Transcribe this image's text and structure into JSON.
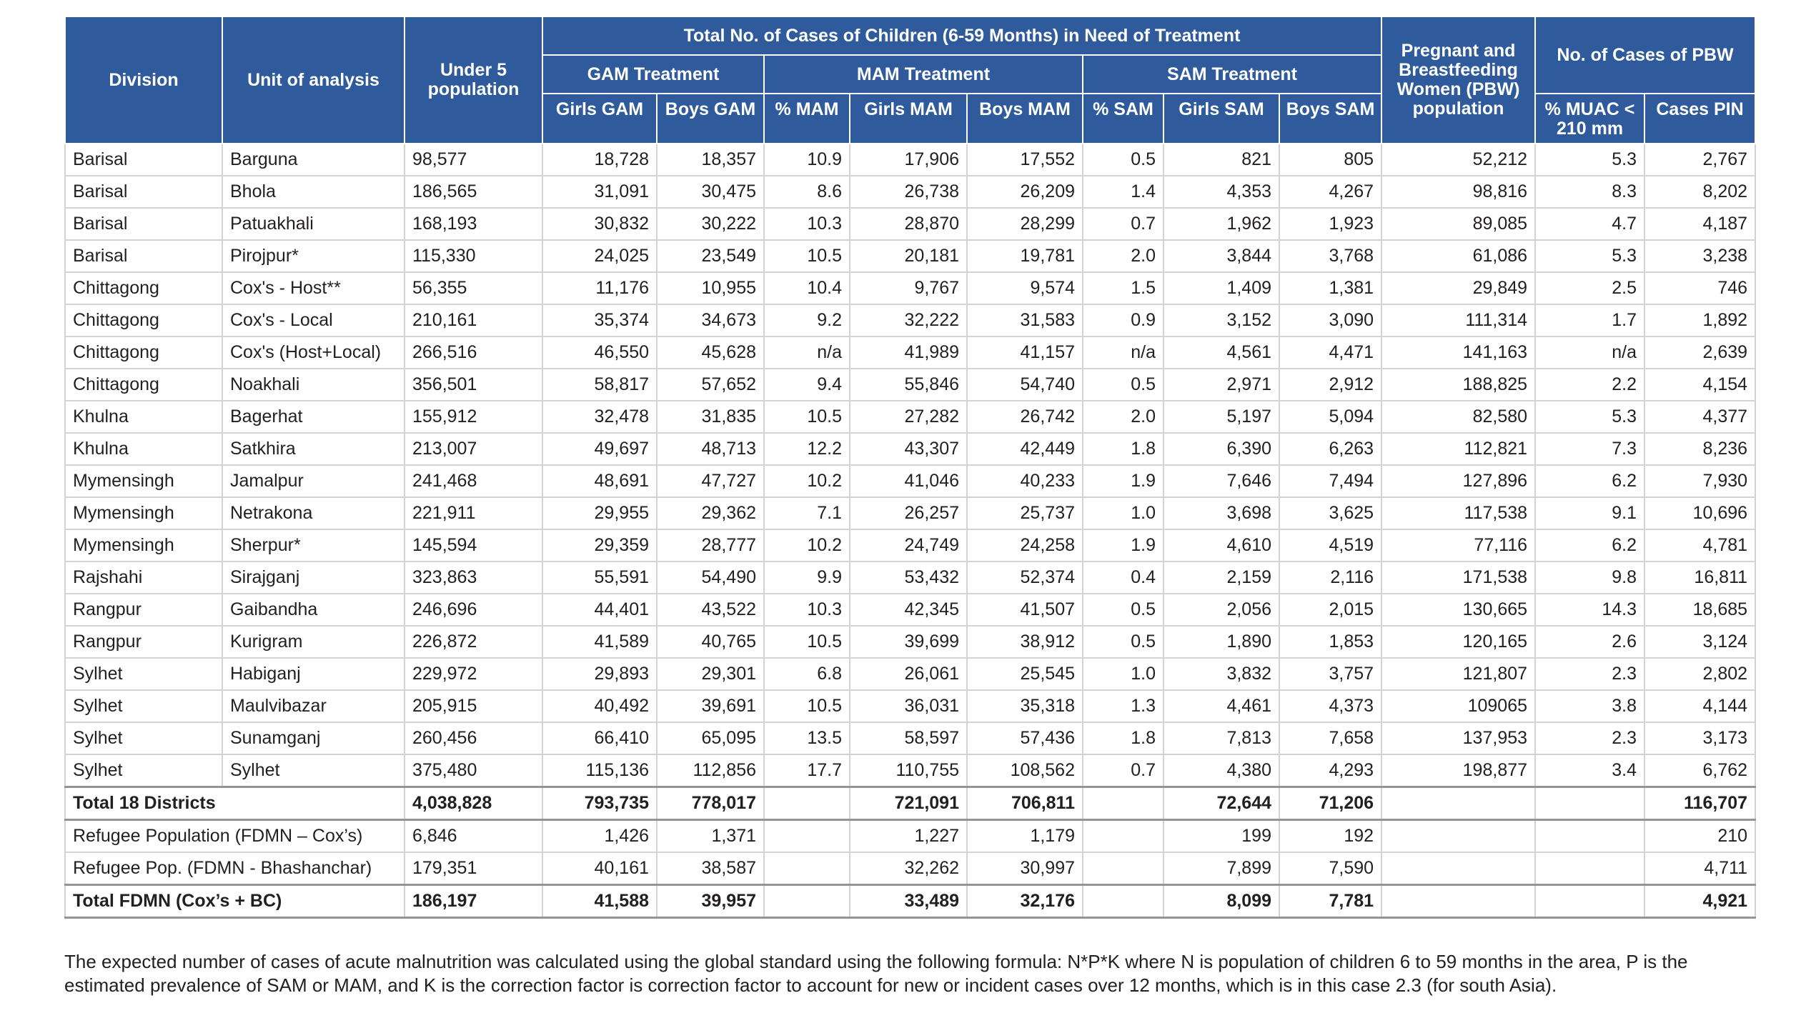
{
  "headers": {
    "division": "Division",
    "unit": "Unit of analysis",
    "under5": "Under 5 population",
    "total_cases": "Total No. of Cases of Children (6-59 Months) in Need of Treatment",
    "gam": "GAM Treatment",
    "mam": "MAM Treatment",
    "sam": "SAM Treatment",
    "pbw_pop": "Pregnant and Breastfeeding Women (PBW) population",
    "pbw_cases": "No. of Cases of PBW",
    "girls_gam": "Girls GAM",
    "boys_gam": "Boys GAM",
    "pct_mam": "% MAM",
    "girls_mam": "Girls MAM",
    "boys_mam": "Boys MAM",
    "pct_sam": "% SAM",
    "girls_sam": "Girls SAM",
    "boys_sam": "Boys SAM",
    "pct_muac": "% MUAC < 210 mm",
    "cases_pin": "Cases PIN"
  },
  "rows": [
    [
      "Barisal",
      "Barguna",
      "98,577",
      "18,728",
      "18,357",
      "10.9",
      "17,906",
      "17,552",
      "0.5",
      "821",
      "805",
      "52,212",
      "5.3",
      "2,767"
    ],
    [
      "Barisal",
      "Bhola",
      "186,565",
      "31,091",
      "30,475",
      "8.6",
      "26,738",
      "26,209",
      "1.4",
      "4,353",
      "4,267",
      "98,816",
      "8.3",
      "8,202"
    ],
    [
      "Barisal",
      "Patuakhali",
      "168,193",
      "30,832",
      "30,222",
      "10.3",
      "28,870",
      "28,299",
      "0.7",
      "1,962",
      "1,923",
      "89,085",
      "4.7",
      "4,187"
    ],
    [
      "Barisal",
      "Pirojpur*",
      "115,330",
      "24,025",
      "23,549",
      "10.5",
      "20,181",
      "19,781",
      "2.0",
      "3,844",
      "3,768",
      "61,086",
      "5.3",
      "3,238"
    ],
    [
      "Chittagong",
      "Cox's - Host**",
      "56,355",
      "11,176",
      "10,955",
      "10.4",
      "9,767",
      "9,574",
      "1.5",
      "1,409",
      "1,381",
      "29,849",
      "2.5",
      "746"
    ],
    [
      "Chittagong",
      "Cox's - Local",
      "210,161",
      "35,374",
      "34,673",
      "9.2",
      "32,222",
      "31,583",
      "0.9",
      "3,152",
      "3,090",
      "111,314",
      "1.7",
      "1,892"
    ],
    [
      "Chittagong",
      "Cox's (Host+Local)",
      "266,516",
      "46,550",
      "45,628",
      "n/a",
      "41,989",
      "41,157",
      "n/a",
      "4,561",
      "4,471",
      "141,163",
      "n/a",
      "2,639"
    ],
    [
      "Chittagong",
      "Noakhali",
      "356,501",
      "58,817",
      "57,652",
      "9.4",
      "55,846",
      "54,740",
      "0.5",
      "2,971",
      "2,912",
      "188,825",
      "2.2",
      "4,154"
    ],
    [
      "Khulna",
      "Bagerhat",
      "155,912",
      "32,478",
      "31,835",
      "10.5",
      "27,282",
      "26,742",
      "2.0",
      "5,197",
      "5,094",
      "82,580",
      "5.3",
      "4,377"
    ],
    [
      "Khulna",
      "Satkhira",
      "213,007",
      "49,697",
      "48,713",
      "12.2",
      "43,307",
      "42,449",
      "1.8",
      "6,390",
      "6,263",
      "112,821",
      "7.3",
      "8,236"
    ],
    [
      "Mymensingh",
      "Jamalpur",
      "241,468",
      "48,691",
      "47,727",
      "10.2",
      "41,046",
      "40,233",
      "1.9",
      "7,646",
      "7,494",
      "127,896",
      "6.2",
      "7,930"
    ],
    [
      "Mymensingh",
      "Netrakona",
      "221,911",
      "29,955",
      "29,362",
      "7.1",
      "26,257",
      "25,737",
      "1.0",
      "3,698",
      "3,625",
      "117,538",
      "9.1",
      "10,696"
    ],
    [
      "Mymensingh",
      "Sherpur*",
      "145,594",
      "29,359",
      "28,777",
      "10.2",
      "24,749",
      "24,258",
      "1.9",
      "4,610",
      "4,519",
      "77,116",
      "6.2",
      "4,781"
    ],
    [
      "Rajshahi",
      "Sirajganj",
      "323,863",
      "55,591",
      "54,490",
      "9.9",
      "53,432",
      "52,374",
      "0.4",
      "2,159",
      "2,116",
      "171,538",
      "9.8",
      "16,811"
    ],
    [
      "Rangpur",
      "Gaibandha",
      "246,696",
      "44,401",
      "43,522",
      "10.3",
      "42,345",
      "41,507",
      "0.5",
      "2,056",
      "2,015",
      "130,665",
      "14.3",
      "18,685"
    ],
    [
      "Rangpur",
      "Kurigram",
      "226,872",
      "41,589",
      "40,765",
      "10.5",
      "39,699",
      "38,912",
      "0.5",
      "1,890",
      "1,853",
      "120,165",
      "2.6",
      "3,124"
    ],
    [
      "Sylhet",
      "Habiganj",
      "229,972",
      "29,893",
      "29,301",
      "6.8",
      "26,061",
      "25,545",
      "1.0",
      "3,832",
      "3,757",
      "121,807",
      "2.3",
      "2,802"
    ],
    [
      "Sylhet",
      "Maulvibazar",
      "205,915",
      "40,492",
      "39,691",
      "10.5",
      "36,031",
      "35,318",
      "1.3",
      "4,461",
      "4,373",
      "109065",
      "3.8",
      "4,144"
    ],
    [
      "Sylhet",
      "Sunamganj",
      "260,456",
      "66,410",
      "65,095",
      "13.5",
      "58,597",
      "57,436",
      "1.8",
      "7,813",
      "7,658",
      "137,953",
      "2.3",
      "3,173"
    ],
    [
      "Sylhet",
      "Sylhet",
      "375,480",
      "115,136",
      "112,856",
      "17.7",
      "110,755",
      "108,562",
      "0.7",
      "4,380",
      "4,293",
      "198,877",
      "3.4",
      "6,762"
    ]
  ],
  "total18": {
    "label": "Total 18 Districts",
    "values": [
      "4,038,828",
      "793,735",
      "778,017",
      "",
      "721,091",
      "706,811",
      "",
      "72,644",
      "71,206",
      "",
      "",
      "116,707"
    ]
  },
  "refugee_rows": [
    {
      "label": "Refugee Population (FDMN – Cox’s)",
      "values": [
        "6,846",
        "1,426",
        "1,371",
        "",
        "1,227",
        "1,179",
        "",
        "199",
        "192",
        "",
        "",
        "210"
      ]
    },
    {
      "label": "Refugee Pop. (FDMN - Bhashanchar)",
      "values": [
        "179,351",
        "40,161",
        "38,587",
        "",
        "32,262",
        "30,997",
        "",
        "7,899",
        "7,590",
        "",
        "",
        "4,711"
      ]
    }
  ],
  "total_fdmn": {
    "label": "Total FDMN (Cox’s + BC)",
    "values": [
      "186,197",
      "41,588",
      "39,957",
      "",
      "33,489",
      "32,176",
      "",
      "8,099",
      "7,781",
      "",
      "",
      "4,921"
    ]
  },
  "footnote": "The expected number of cases of acute malnutrition was calculated using the global standard using the following formula: N*P*K where N is population of children 6 to 59 months in the area, P is the estimated prevalence of SAM or MAM, and K is the correction factor is correction factor to account for new or incident cases over 12 months, which is in this case 2.3 (for south Asia).",
  "colors": {
    "header_bg": "#2f5b9c",
    "header_text": "#ffffff",
    "grid": "#d2d3d5"
  }
}
